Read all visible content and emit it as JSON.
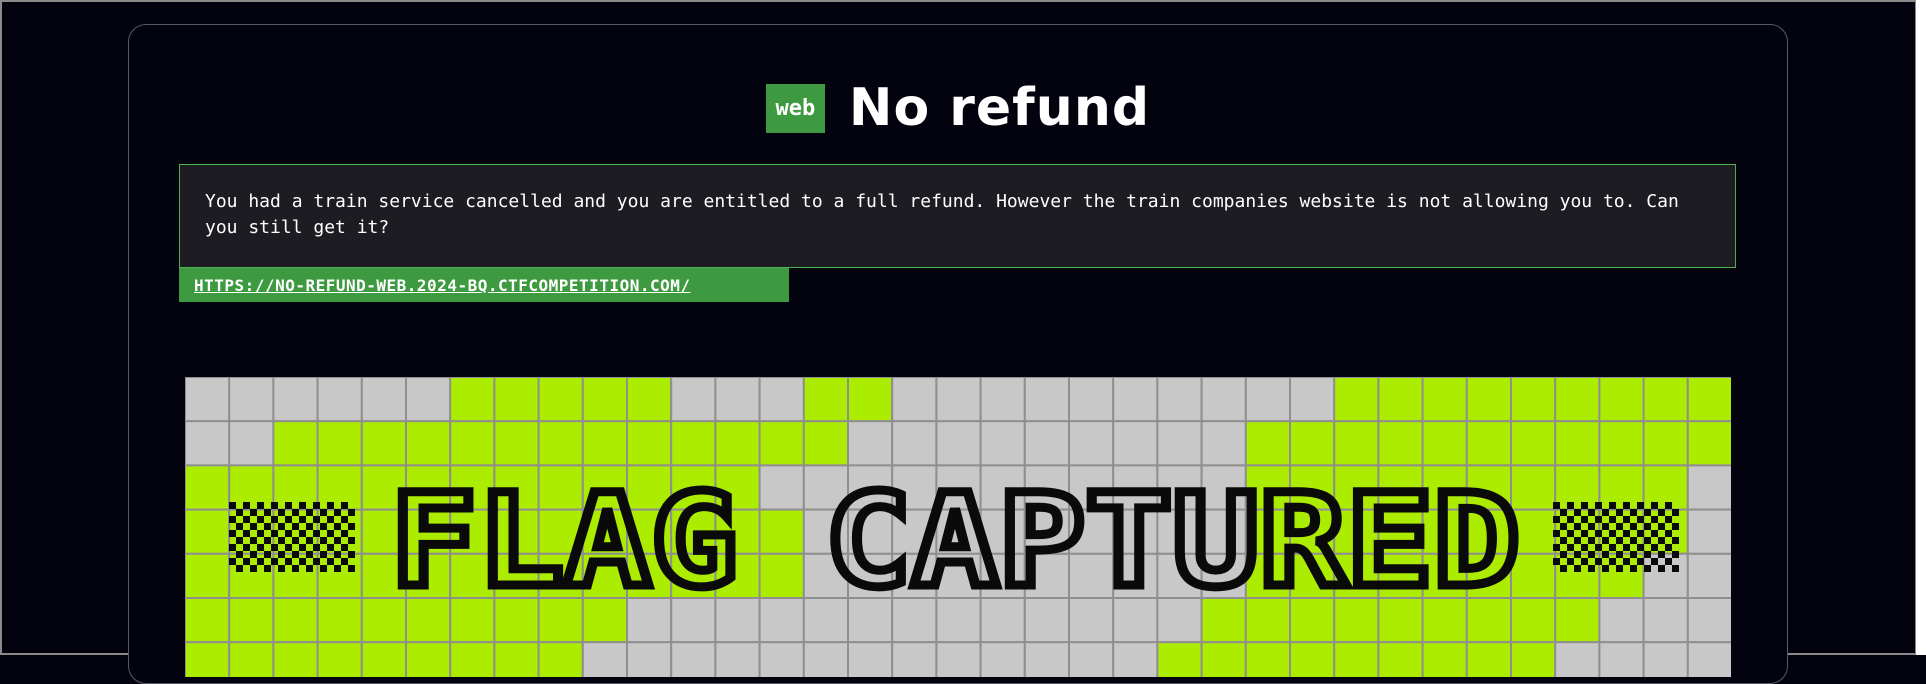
{
  "challenge": {
    "category_badge": "web",
    "title": "No refund",
    "description": "You had a train service cancelled and you are entitled to a full refund. However the train companies website is not allowing you to. Can you still get it?",
    "link_text": "HTTPS://NO-REFUND-WEB.2024-BQ.CTFCOMPETITION.COM/"
  },
  "banner": {
    "text": "FLAG CAPTURED",
    "colors": {
      "lime": "#acec00",
      "gray": "#c8c8c8",
      "grid": "#8f8f8f",
      "ink": "#0a0a0a"
    }
  },
  "colors": {
    "background": "#03020f",
    "accent": "#3e9a41",
    "description_bg": "#1c1c22",
    "description_border": "#4caf50"
  }
}
